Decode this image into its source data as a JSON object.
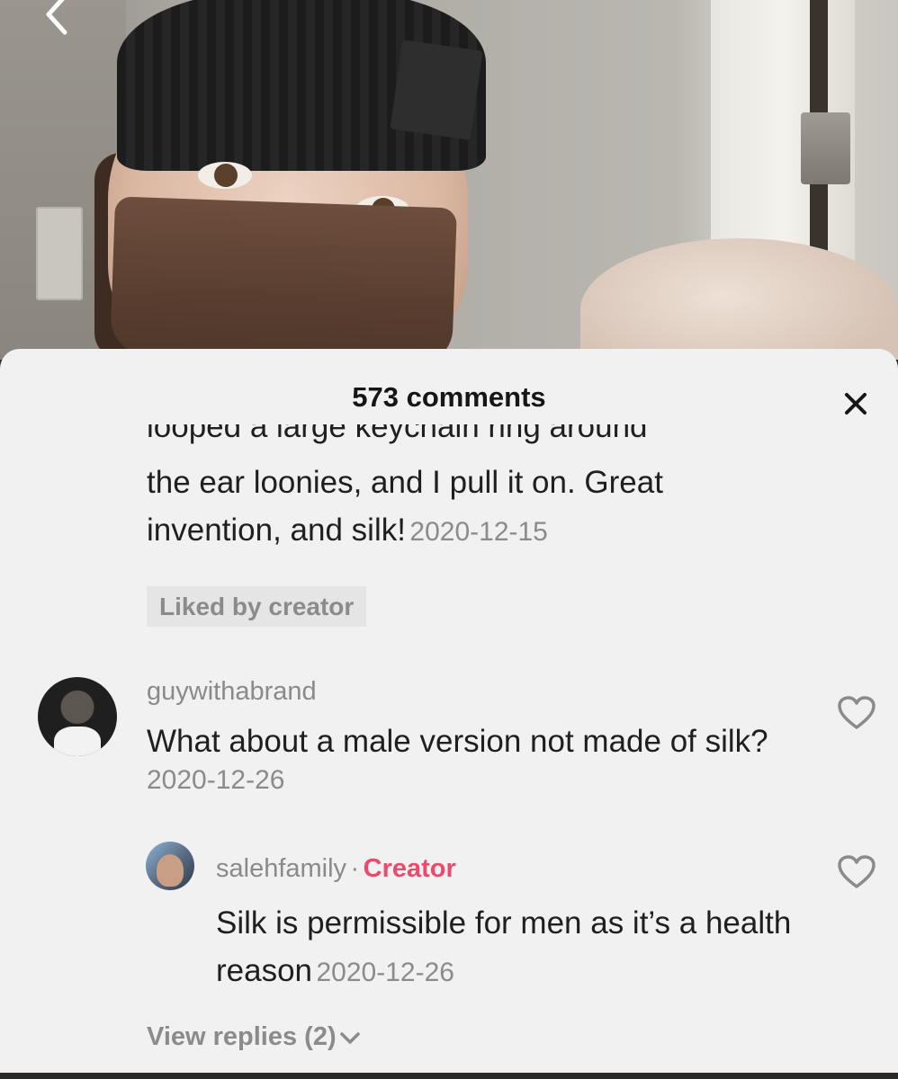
{
  "header": {
    "title": "573 comments"
  },
  "comments": {
    "partial": {
      "text_cut": "looped a large keychain ring around",
      "text": "the ear loonies, and I pull it on. Great invention, and silk!",
      "date": "2020-12-15",
      "badge": "Liked by creator"
    },
    "items": [
      {
        "username": "guywithabrand",
        "text": "What about a male version not made of silk?",
        "date": "2020-12-26",
        "replies": [
          {
            "username": "salehfamily",
            "separator": "·",
            "tag": "Creator",
            "text": "Silk is permissible for men as it’s a health reason",
            "date": "2020-12-26"
          }
        ],
        "view_replies": "View replies (2)"
      }
    ]
  },
  "colors": {
    "creator_tag": "#ea4a6b",
    "sheet_background": "#f1f1f1",
    "muted_text": "#8b8b8b"
  },
  "icons": {
    "back": "chevron-left-icon",
    "close": "close-icon",
    "like": "heart-outline-icon",
    "expand": "chevron-down-icon"
  }
}
